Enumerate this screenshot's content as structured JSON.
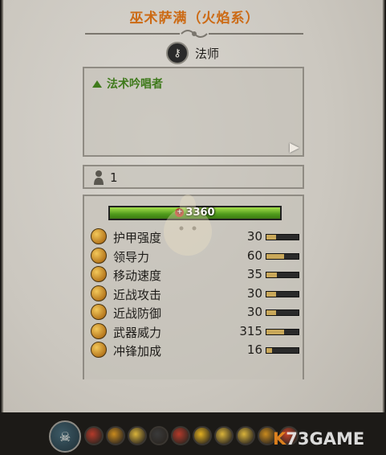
{
  "unit": {
    "title": "巫术萨满（火焰系）",
    "class_label": "法师",
    "class_icon": "key-icon",
    "ability": "法术吟唱者",
    "rank_value": "1"
  },
  "health": {
    "value_text": "3360",
    "fraction": 1.0
  },
  "stats": [
    {
      "label": "护甲强度",
      "value": "30",
      "icon": "armor-icon",
      "bar": 0.3
    },
    {
      "label": "领导力",
      "value": "60",
      "icon": "leadership-icon",
      "bar": 0.55
    },
    {
      "label": "移动速度",
      "value": "35",
      "icon": "speed-icon",
      "bar": 0.33
    },
    {
      "label": "近战攻击",
      "value": "30",
      "icon": "melee-attack-icon",
      "bar": 0.3
    },
    {
      "label": "近战防御",
      "value": "30",
      "icon": "melee-defense-icon",
      "bar": 0.3
    },
    {
      "label": "武器威力",
      "value": "315",
      "icon": "weapon-strength-icon",
      "bar": 0.55
    },
    {
      "label": "冲锋加成",
      "value": "16",
      "icon": "charge-bonus-icon",
      "bar": 0.18
    }
  ],
  "ability_bar": [
    {
      "icon": "ability-1-icon",
      "color": "#b43a2a"
    },
    {
      "icon": "ability-2-icon",
      "color": "#c98a1e"
    },
    {
      "icon": "ability-3-icon",
      "color": "#d9b33a"
    },
    {
      "icon": "ability-4-icon",
      "color": "#3a3a3a"
    },
    {
      "icon": "ability-5-icon",
      "color": "#b43a2a"
    },
    {
      "icon": "ability-6-icon",
      "color": "#e2b020"
    },
    {
      "icon": "ability-7-icon",
      "color": "#d9b33a"
    },
    {
      "icon": "ability-8-icon",
      "color": "#d9b33a"
    },
    {
      "icon": "ability-9-icon",
      "color": "#c98a1e"
    },
    {
      "icon": "ability-10-icon",
      "color": "#c9432a"
    }
  ],
  "watermark": {
    "prefix": "K",
    "rest": "73",
    "suffix": "GAME"
  },
  "colors": {
    "title": "#cc6a14",
    "ability_text": "#3f7a1c",
    "health_fill": "#4f9a1c"
  }
}
